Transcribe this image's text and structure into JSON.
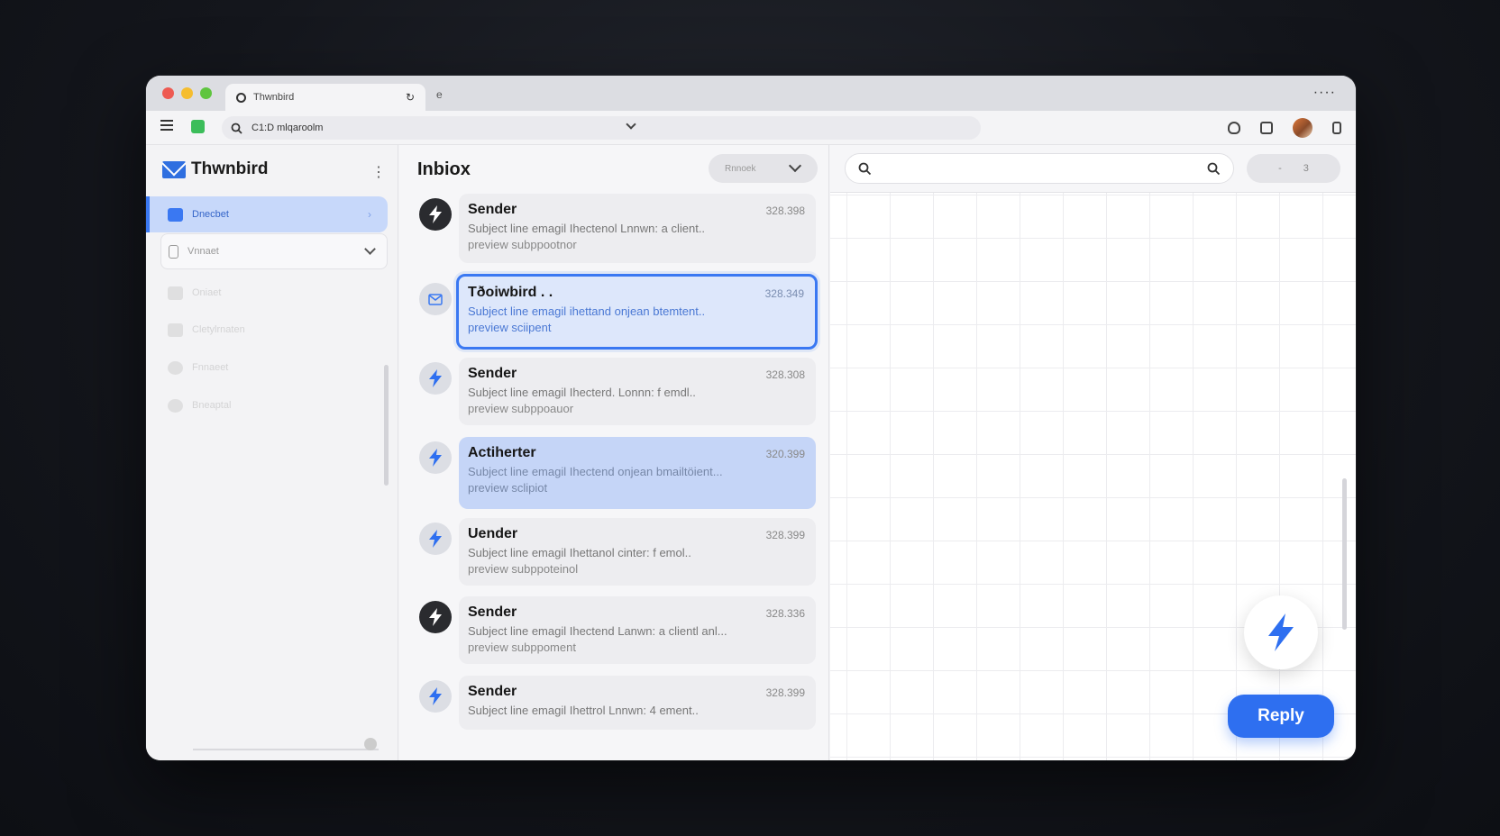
{
  "browser": {
    "tab_title": "Thwnbird",
    "new_tab_glyph": "e",
    "menu_dots": "····",
    "url": "C1:D mlqaroolm",
    "icons": [
      "menu-icon",
      "extension-icon",
      "search-icon",
      "chevron-down-icon",
      "shield-icon",
      "sidebar-icon",
      "avatar",
      "list-icon"
    ]
  },
  "sidebar": {
    "app_name": "Thwnbird",
    "items": [
      {
        "label": "Dnecbet",
        "icon": "inbox-icon",
        "state": "active"
      },
      {
        "label": "Vnnaet",
        "icon": "phone-icon",
        "state": "expandable"
      },
      {
        "label": "Oniaet",
        "icon": "folder-icon",
        "state": "faded"
      },
      {
        "label": "Cletylrnaten",
        "icon": "archive-icon",
        "state": "faded"
      },
      {
        "label": "Fnnaeet",
        "icon": "star-icon",
        "state": "faded"
      },
      {
        "label": "Bneaptal",
        "icon": "trash-icon",
        "state": "faded"
      }
    ]
  },
  "list": {
    "title": "Inbiox",
    "sort_label": "Rnnoek",
    "messages": [
      {
        "sender": "Sender",
        "date": "328.398",
        "subject": "Subject line emagil Ihectenol Lnnwn: a client..",
        "preview": "preview subppootnor",
        "avatar": "dark",
        "style": "normal"
      },
      {
        "sender": "Tðoiwbird . .",
        "date": "328.349",
        "subject": "Subject line emagil ihettand onjean btemtent..",
        "preview": "preview sciipent",
        "avatar": "light",
        "style": "selected"
      },
      {
        "sender": "Sender",
        "date": "328.308",
        "subject": "Subject line emagil Ihecterd. Lonnn: f emdl..",
        "preview": "preview subppoauor",
        "avatar": "light",
        "style": "normal"
      },
      {
        "sender": "Actiherter",
        "date": "320.399",
        "subject": "Subject line emagil Ihectend onjean bmailtöient...",
        "preview": "preview sclipiot",
        "avatar": "light",
        "style": "blue"
      },
      {
        "sender": "Uender",
        "date": "328.399",
        "subject": "Subject line emagil Ihettanol cinter: f emol..",
        "preview": "preview subppoteinol",
        "avatar": "light",
        "style": "normal"
      },
      {
        "sender": "Sender",
        "date": "328.336",
        "subject": "Subject line emagil Ihectend Lanwn: a clientl anl...",
        "preview": "preview subppoment",
        "avatar": "dark",
        "style": "normal"
      },
      {
        "sender": "Sender",
        "date": "328.399",
        "subject": "Subject line emagil Ihettrol Lnnwn: 4 ement..",
        "preview": "",
        "avatar": "light",
        "style": "normal"
      }
    ]
  },
  "reader": {
    "search_placeholder": "",
    "action_left": "-",
    "action_right": "3",
    "reply_label": "Reply"
  },
  "colors": {
    "accent": "#2e6ff0",
    "selected_fill": "#dde7fb",
    "highlight_fill": "#c5d5f7"
  }
}
